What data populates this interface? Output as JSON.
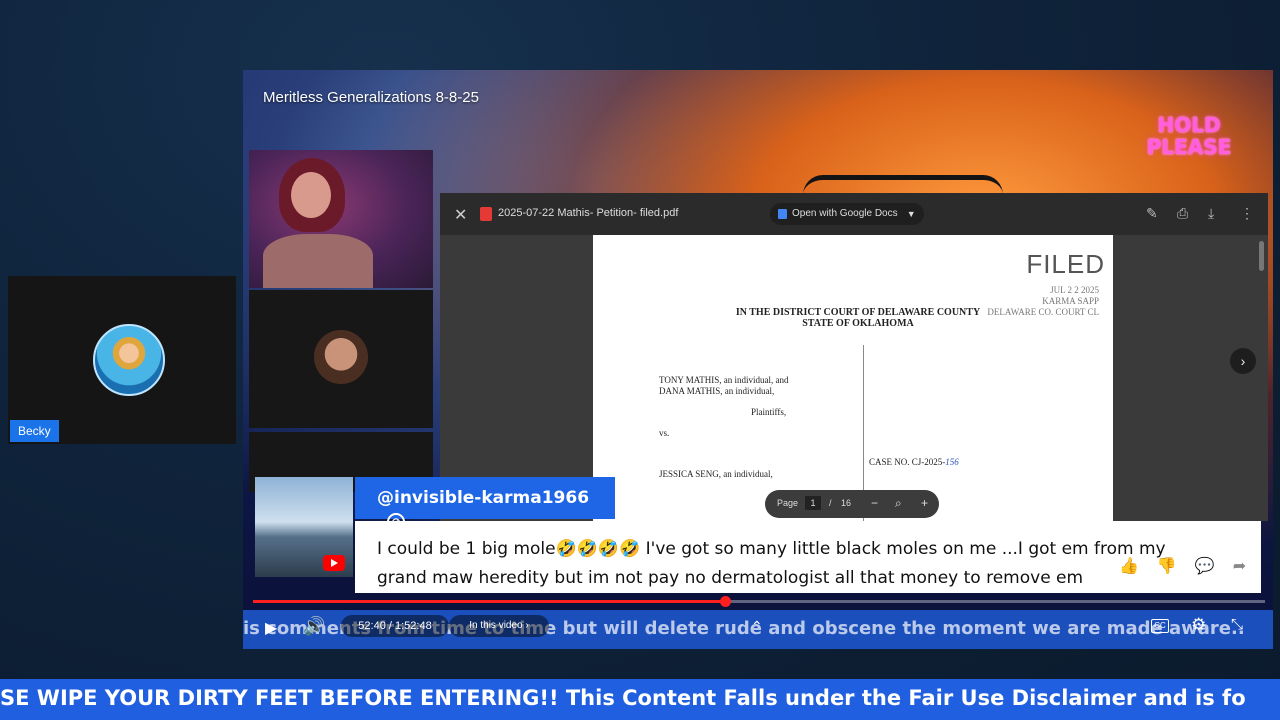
{
  "participant": {
    "name": "Becky"
  },
  "video": {
    "title": "Meritless Generalizations 8-8-25",
    "overlay_badge": [
      "HOLD",
      "PLEASE"
    ]
  },
  "pdf_viewer": {
    "filename": "2025-07-22 Mathis- Petition- filed.pdf",
    "open_with_label": "Open with Google Docs",
    "close_icon": "close-icon",
    "tools": [
      "edit-icon",
      "print-icon",
      "download-icon",
      "more-icon"
    ],
    "page": {
      "stamp": "FILED",
      "stamp_lines": [
        "JUL 2 2 2025",
        "KARMA SAPP",
        "DELAWARE CO. COURT CL"
      ],
      "court_lines": [
        "IN THE DISTRICT COURT OF DELAWARE COUNTY",
        "STATE OF OKLAHOMA"
      ],
      "party_lines": [
        "TONY MATHIS, an individual, and",
        "DANA MATHIS, an individual,",
        "Plaintiffs,",
        "vs.",
        "JESSICA SENG, an individual,"
      ],
      "case_label": "CASE NO. CJ-2025-",
      "case_handwritten": "156"
    },
    "pager": {
      "label": "Page",
      "current": "1",
      "sep": "/",
      "total": "16"
    }
  },
  "comment": {
    "username": "@invisible-karma1966",
    "text_line1": "I could be 1 big mole🤣🤣🤣🤣 I've got so many little black moles on me ...I got em from my",
    "text_line2": "grand maw heredity but im not pay no dermatologist all that money to remove em"
  },
  "player": {
    "time": "52:40 / 1:52:48",
    "chapter": "In this video",
    "progress_fraction": 0.466,
    "ticker": "is comments from time to time but will delete rude and obscene the moment we are made aware.."
  },
  "bottom_ticker": "SE WIPE YOUR DIRTY FEET BEFORE ENTERING!! This Content Falls under the Fair Use Disclaimer and is fo",
  "colors": {
    "accent": "#1f5fe0",
    "progress": "#ff1f1f",
    "comment_header": "#1e66e6"
  }
}
